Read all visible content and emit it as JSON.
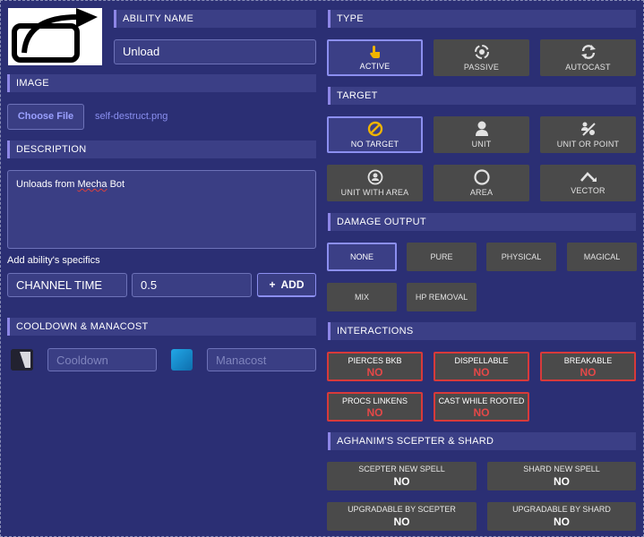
{
  "left": {
    "ability_name": {
      "header": "ABILITY NAME",
      "value": "Unload"
    },
    "image": {
      "header": "IMAGE",
      "button": "Choose File",
      "filename": "self-destruct.png"
    },
    "description": {
      "header": "DESCRIPTION",
      "text_before": "Unloads from ",
      "text_word": "Mecha",
      "text_after": " Bot"
    },
    "specifics": {
      "label": "Add ability's specifics",
      "key": "CHANNEL TIME",
      "value": "0.5",
      "add_button": "ADD",
      "add_icon": "+"
    },
    "cooldown": {
      "header": "COOLDOWN & MANACOST",
      "cooldown_placeholder": "Cooldown",
      "manacost_placeholder": "Manacost"
    }
  },
  "right": {
    "type": {
      "header": "TYPE",
      "options": [
        {
          "label": "ACTIVE",
          "icon": "pointer-hand-icon",
          "selected": true
        },
        {
          "label": "PASSIVE",
          "icon": "passive-ring-icon",
          "selected": false
        },
        {
          "label": "AUTOCAST",
          "icon": "refresh-arrows-icon",
          "selected": false
        }
      ]
    },
    "target": {
      "header": "TARGET",
      "options": [
        {
          "label": "NO TARGET",
          "icon": "no-target-icon",
          "selected": true
        },
        {
          "label": "UNIT",
          "icon": "person-icon",
          "selected": false
        },
        {
          "label": "UNIT OR POINT",
          "icon": "unit-or-point-icon",
          "selected": false
        },
        {
          "label": "UNIT WITH AREA",
          "icon": "person-circle-icon",
          "selected": false
        },
        {
          "label": "AREA",
          "icon": "circle-icon",
          "selected": false
        },
        {
          "label": "VECTOR",
          "icon": "vector-arrow-icon",
          "selected": false
        }
      ]
    },
    "damage": {
      "header": "DAMAGE OUTPUT",
      "options": [
        {
          "label": "NONE",
          "selected": true
        },
        {
          "label": "PURE",
          "selected": false
        },
        {
          "label": "PHYSICAL",
          "selected": false
        },
        {
          "label": "MAGICAL",
          "selected": false
        },
        {
          "label": "MIX",
          "selected": false
        },
        {
          "label": "HP REMOVAL",
          "selected": false
        }
      ]
    },
    "interactions": {
      "header": "INTERACTIONS",
      "items": [
        {
          "label": "PIERCES BKB",
          "value": "NO"
        },
        {
          "label": "DISPELLABLE",
          "value": "NO"
        },
        {
          "label": "BREAKABLE",
          "value": "NO"
        },
        {
          "label": "PROCS LINKENS",
          "value": "NO"
        },
        {
          "label": "CAST WHILE ROOTED",
          "value": "NO"
        }
      ]
    },
    "aghanim": {
      "header": "AGHANIM'S SCEPTER & SHARD",
      "items": [
        {
          "label": "SCEPTER NEW SPELL",
          "value": "NO"
        },
        {
          "label": "SHARD NEW SPELL",
          "value": "NO"
        },
        {
          "label": "UPGRADABLE BY SCEPTER",
          "value": "NO"
        },
        {
          "label": "UPGRADABLE BY SHARD",
          "value": "NO"
        }
      ]
    }
  },
  "colors": {
    "background": "#2b2f74",
    "panel": "#3a3e84",
    "accent": "#8d86e6",
    "tile": "#4a4a4a",
    "danger": "#d83a3a"
  }
}
